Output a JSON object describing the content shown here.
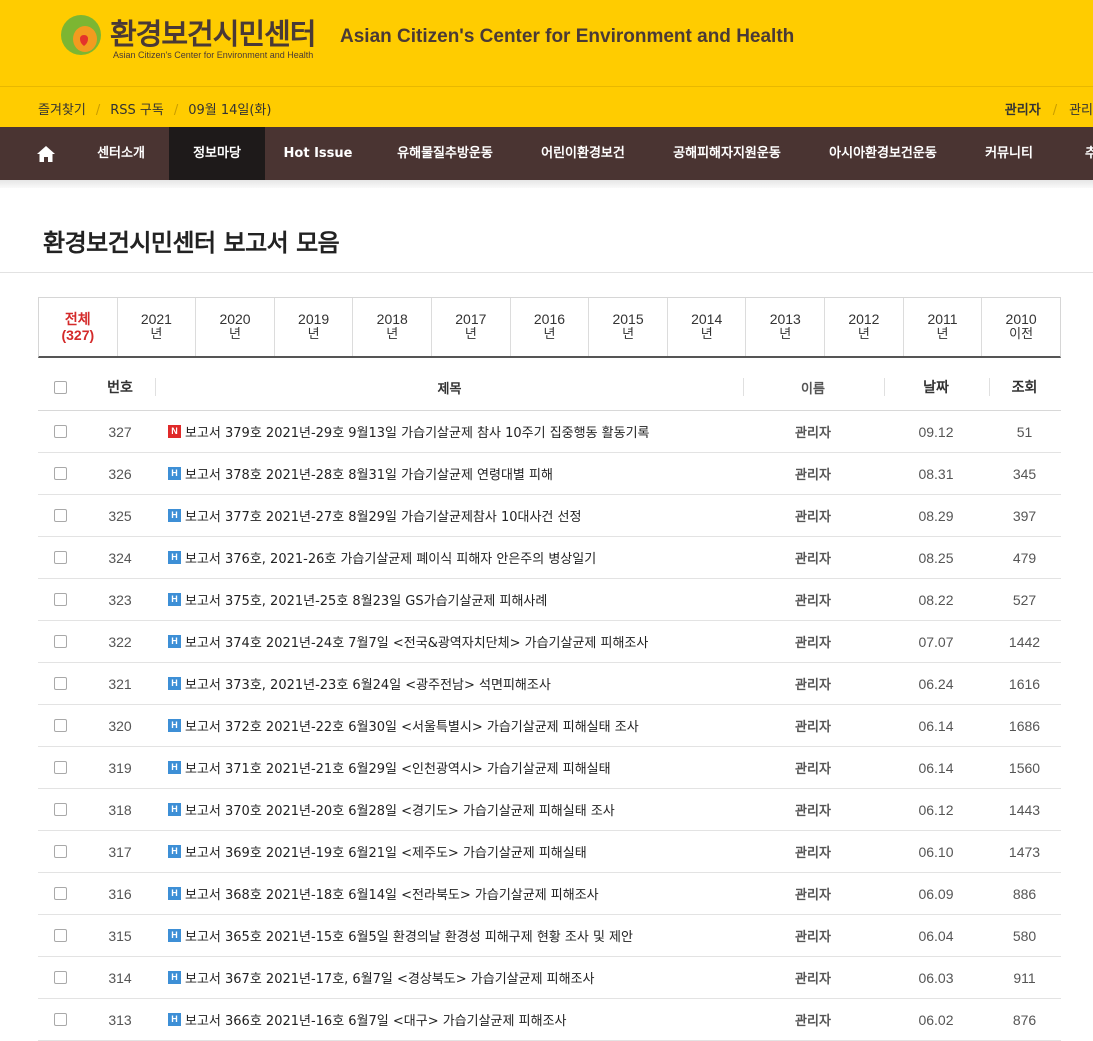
{
  "header": {
    "logo_ko": "환경보건시민센터",
    "logo_en_small": "Asian Citizen's Center for Environment and Health",
    "title_en": "Asian Citizen's Center for Environment and Health"
  },
  "utilbar": {
    "favorites": "즐겨찾기",
    "rss": "RSS 구독",
    "date": "09월 14일(화)",
    "user": "관리자",
    "admin": "관리"
  },
  "nav": {
    "home_icon": "home-icon",
    "items": [
      {
        "label": "센터소개"
      },
      {
        "label": "정보마당",
        "active": true
      },
      {
        "label": "Hot Issue"
      },
      {
        "label": "유해물질추방운동"
      },
      {
        "label": "어린이환경보건"
      },
      {
        "label": "공해피해자지원운동"
      },
      {
        "label": "아시아환경보건운동"
      },
      {
        "label": "커뮤니티"
      },
      {
        "label": "추"
      }
    ]
  },
  "page": {
    "title": "환경보건시민센터 보고서 모음"
  },
  "tabs": [
    {
      "l1": "전체",
      "l2": "(327)",
      "active": true
    },
    {
      "l1": "2021",
      "l2": "년"
    },
    {
      "l1": "2020",
      "l2": "년"
    },
    {
      "l1": "2019",
      "l2": "년"
    },
    {
      "l1": "2018",
      "l2": "년"
    },
    {
      "l1": "2017",
      "l2": "년"
    },
    {
      "l1": "2016",
      "l2": "년"
    },
    {
      "l1": "2015",
      "l2": "년"
    },
    {
      "l1": "2014",
      "l2": "년"
    },
    {
      "l1": "2013",
      "l2": "년"
    },
    {
      "l1": "2012",
      "l2": "년"
    },
    {
      "l1": "2011",
      "l2": "년"
    },
    {
      "l1": "2010",
      "l2": "이전"
    }
  ],
  "table": {
    "headers": {
      "num": "번호",
      "title": "제목",
      "name": "이름",
      "date": "날짜",
      "views": "조회"
    },
    "badge_colors": {
      "new": "#e02a2a",
      "hot": "#3d8fd6"
    },
    "rows": [
      {
        "num": "327",
        "badge": "N",
        "title": "보고서 379호 2021년-29호 9월13일 가습기살균제 참사 10주기 집중행동 활동기록",
        "name": "관리자",
        "date": "09.12",
        "views": "51"
      },
      {
        "num": "326",
        "badge": "H",
        "title": "보고서 378호 2021년-28호 8월31일 가습기살균제 연령대별 피해",
        "name": "관리자",
        "date": "08.31",
        "views": "345"
      },
      {
        "num": "325",
        "badge": "H",
        "title": "보고서 377호 2021년-27호 8월29일 가습기살균제참사 10대사건 선정",
        "name": "관리자",
        "date": "08.29",
        "views": "397"
      },
      {
        "num": "324",
        "badge": "H",
        "title": "보고서 376호, 2021-26호 가습기살균제 폐이식 피해자 안은주의 병상일기",
        "name": "관리자",
        "date": "08.25",
        "views": "479"
      },
      {
        "num": "323",
        "badge": "H",
        "title": "보고서 375호, 2021년-25호 8월23일 GS가습기살균제 피해사례",
        "name": "관리자",
        "date": "08.22",
        "views": "527"
      },
      {
        "num": "322",
        "badge": "H",
        "title": "보고서 374호 2021년-24호 7월7일 <전국&광역자치단체> 가습기살균제 피해조사",
        "name": "관리자",
        "date": "07.07",
        "views": "1442"
      },
      {
        "num": "321",
        "badge": "H",
        "title": "보고서 373호, 2021년-23호 6월24일 <광주전남> 석면피해조사",
        "name": "관리자",
        "date": "06.24",
        "views": "1616"
      },
      {
        "num": "320",
        "badge": "H",
        "title": "보고서 372호 2021년-22호 6월30일 <서울특별시> 가습기살균제 피해실태 조사",
        "name": "관리자",
        "date": "06.14",
        "views": "1686"
      },
      {
        "num": "319",
        "badge": "H",
        "title": "보고서 371호 2021년-21호 6월29일 <인천광역시> 가습기살균제 피해실태",
        "name": "관리자",
        "date": "06.14",
        "views": "1560"
      },
      {
        "num": "318",
        "badge": "H",
        "title": "보고서 370호 2021년-20호 6월28일 <경기도> 가습기살균제 피해실태 조사",
        "name": "관리자",
        "date": "06.12",
        "views": "1443"
      },
      {
        "num": "317",
        "badge": "H",
        "title": "보고서 369호 2021년-19호 6월21일 <제주도> 가습기살균제 피해실태",
        "name": "관리자",
        "date": "06.10",
        "views": "1473"
      },
      {
        "num": "316",
        "badge": "H",
        "title": "보고서 368호 2021년-18호 6월14일 <전라북도> 가습기살균제 피해조사",
        "name": "관리자",
        "date": "06.09",
        "views": "886"
      },
      {
        "num": "315",
        "badge": "H",
        "title": "보고서 365호 2021년-15호 6월5일 환경의날 환경성 피해구제 현황 조사 및 제안",
        "name": "관리자",
        "date": "06.04",
        "views": "580"
      },
      {
        "num": "314",
        "badge": "H",
        "title": "보고서 367호 2021년-17호, 6월7일 <경상북도> 가습기살균제 피해조사",
        "name": "관리자",
        "date": "06.03",
        "views": "911"
      },
      {
        "num": "313",
        "badge": "H",
        "title": "보고서 366호 2021년-16호 6월7일 <대구> 가습기살균제 피해조사",
        "name": "관리자",
        "date": "06.02",
        "views": "876"
      }
    ]
  }
}
